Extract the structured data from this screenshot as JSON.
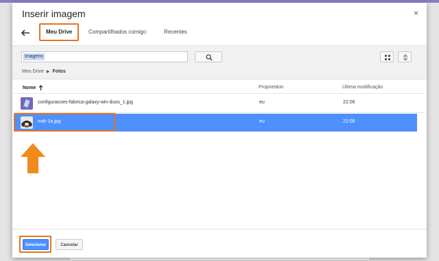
{
  "dialog": {
    "title": "Inserir imagem",
    "close_glyph": "×"
  },
  "tabs": [
    {
      "label": "Meu Drive",
      "active": true
    },
    {
      "label": "Compartilhados comigo",
      "active": false
    },
    {
      "label": "Recentes",
      "active": false
    }
  ],
  "search": {
    "chip": "Imagens",
    "value": ""
  },
  "breadcrumb": {
    "root": "Meu Drive",
    "current": "Fotos"
  },
  "columns": {
    "name": "Nome",
    "owner": "Proprietário",
    "modified": "Última modificação"
  },
  "files": [
    {
      "name": "configuracoes-fabrica-galaxy-win-duos_1.jpg",
      "owner": "eu",
      "modified": "22:06",
      "selected": false
    },
    {
      "name": "mdr-1a.jpg",
      "owner": "eu",
      "modified": "22:06",
      "selected": true
    }
  ],
  "buttons": {
    "select": "Selecionar",
    "cancel": "Cancelar"
  },
  "colors": {
    "accent": "#4d90fe",
    "highlight_outline": "#e6731f",
    "header_bar": "#8e7cc3"
  },
  "icons": [
    "back-arrow-icon",
    "close-icon",
    "search-icon",
    "grid-view-icon",
    "sort-icon",
    "sort-up-arrow-icon",
    "annotation-arrow-icon"
  ]
}
